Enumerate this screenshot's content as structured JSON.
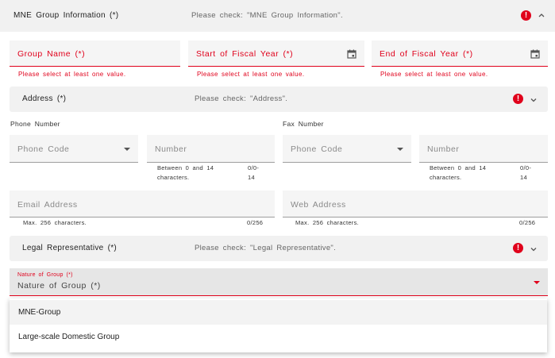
{
  "mne_section": {
    "title": "MNE Group Information (*)",
    "check": "Please check: \"MNE Group Information\".",
    "alert": "!",
    "fields": {
      "group_name": {
        "placeholder": "Group Name (*)",
        "error": "Please select at least one value."
      },
      "start_fiscal": {
        "placeholder": "Start of Fiscal Year (*)",
        "error": "Please select at least one value."
      },
      "end_fiscal": {
        "placeholder": "End of Fiscal Year (*)",
        "error": "Please select at least one value."
      }
    }
  },
  "address_section": {
    "title": "Address (*)",
    "check": "Please check: \"Address\".",
    "alert": "!"
  },
  "contact": {
    "phone_label": "Phone Number",
    "fax_label": "Fax Number",
    "phone_code_placeholder": "Phone Code",
    "phone_number_placeholder": "Number",
    "phone_hint_line1": "Between 0 and 14",
    "phone_hint_line2": "characters.",
    "phone_count_line1": "0/0-",
    "phone_count_line2": "14",
    "fax_code_placeholder": "Phone Code",
    "fax_number_placeholder": "Number",
    "fax_hint_line1": "Between 0 and 14",
    "fax_hint_line2": "characters.",
    "fax_count_line1": "0/0-",
    "fax_count_line2": "14",
    "email_placeholder": "Email Address",
    "email_hint": "Max. 256 characters.",
    "email_count": "0/256",
    "web_placeholder": "Web Address",
    "web_hint": "Max. 256 characters.",
    "web_count": "0/256"
  },
  "legal_section": {
    "title": "Legal Representative (*)",
    "check": "Please check: \"Legal Representative\".",
    "alert": "!"
  },
  "nature_of_group": {
    "floating_label": "Nature of Group (*)",
    "placeholder": "Nature of Group (*)",
    "options": [
      "MNE-Group",
      "Large-scale Domestic Group"
    ]
  },
  "colors": {
    "error": "#e0001b",
    "panel_bg": "#f1f1f1",
    "field_bg": "#f5f5f5"
  }
}
